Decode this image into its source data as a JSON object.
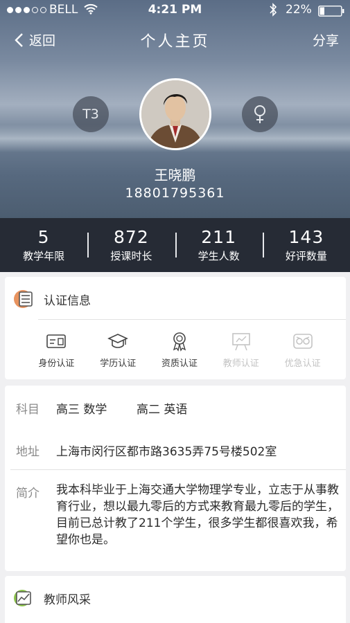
{
  "status_bar": {
    "carrier": "BELL",
    "time": "4:21 PM",
    "battery_percent": "22%",
    "signal_bars_filled": 3,
    "signal_bars_total": 5,
    "battery_level": 0.22
  },
  "nav": {
    "back_label": "返回",
    "title": "个人主页",
    "share_label": "分享"
  },
  "profile": {
    "level_badge": "T3",
    "gender_icon": "female-symbol-icon",
    "name": "王晓鹏",
    "phone": "18801795361"
  },
  "stats": [
    {
      "value": "5",
      "label": "教学年限"
    },
    {
      "value": "872",
      "label": "授课时长"
    },
    {
      "value": "211",
      "label": "学生人数"
    },
    {
      "value": "143",
      "label": "好评数量"
    }
  ],
  "certification": {
    "title": "认证信息",
    "icon": "list-document-icon",
    "items": [
      {
        "label": "身份认证",
        "icon": "id-card-icon",
        "active": true
      },
      {
        "label": "学历认证",
        "icon": "graduation-cap-icon",
        "active": true
      },
      {
        "label": "资质认证",
        "icon": "award-medal-icon",
        "active": true
      },
      {
        "label": "教师认证",
        "icon": "blackboard-icon",
        "active": false
      },
      {
        "label": "优急认证",
        "icon": "owl-icon",
        "active": false
      }
    ]
  },
  "info": {
    "subject_label": "科目",
    "subject_1": "高三 数学",
    "subject_2": "高二 英语",
    "address_label": "地址",
    "address": "上海市闵行区都市路3635弄75号楼502室",
    "intro_label": "简介",
    "intro": "我本科毕业于上海交通大学物理学专业，立志于从事教育行业，想以最九零后的方式来教育最九零后的学生，目前已总计教了211个学生，很多学生都很喜欢我，希望你也是。"
  },
  "style_section": {
    "title": "教师风采",
    "icon": "picture-chart-icon"
  },
  "colors": {
    "stats_bg": "#262b35",
    "accent_orange": "#e8935f",
    "accent_green": "#8bc34a",
    "disabled_gray": "#c3c3c3"
  }
}
